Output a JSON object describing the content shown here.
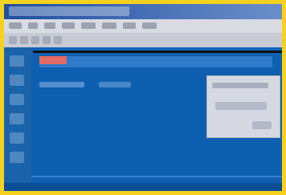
{
  "colors": {
    "frame": "#f6d21e",
    "workspace": "#0f63b8",
    "panel": "#2f7ac9",
    "accent": "#e46b63",
    "dialog": "#d6d9e2"
  }
}
